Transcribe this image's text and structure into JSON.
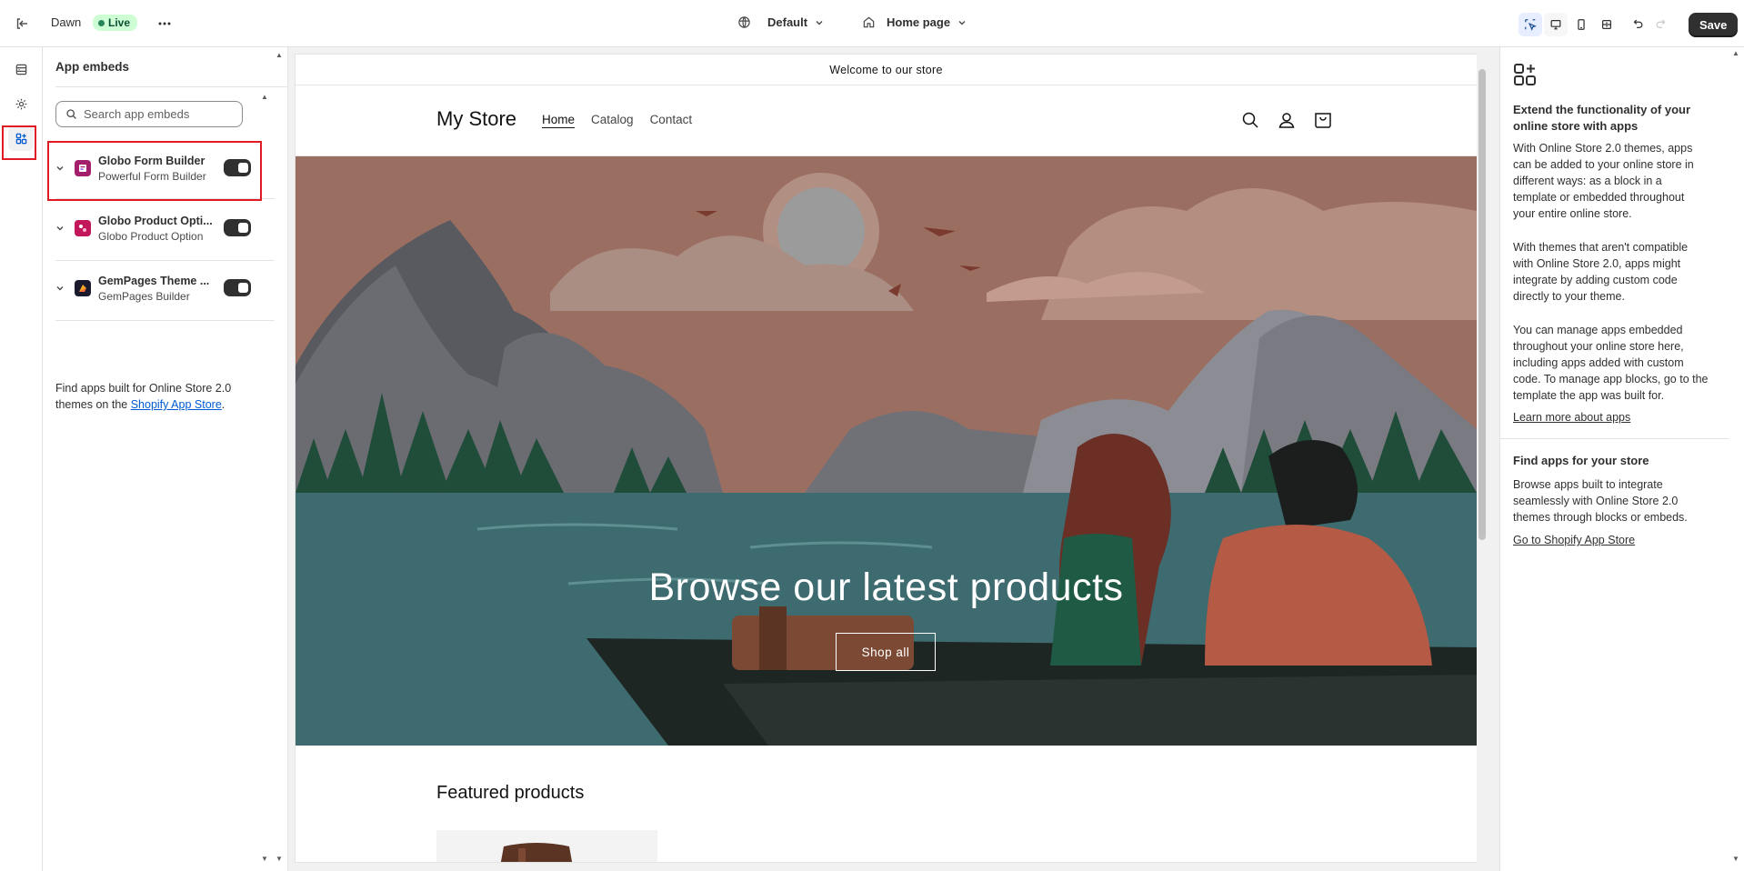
{
  "topbar": {
    "theme_name": "Dawn",
    "live_label": "Live",
    "theme_preset": "Default",
    "page_select": "Home page",
    "save_label": "Save"
  },
  "sidebar": {
    "title": "App embeds",
    "search_placeholder": "Search app embeds",
    "apps": [
      {
        "name": "Globo Form Builder",
        "subtitle": "Powerful Form Builder",
        "enabled": true
      },
      {
        "name": "Globo Product Opti...",
        "subtitle": "Globo Product Option",
        "enabled": true
      },
      {
        "name": "GemPages Theme ...",
        "subtitle": "GemPages Builder",
        "enabled": true
      }
    ],
    "footer_text": "Find apps built for Online Store 2.0 themes on the",
    "footer_link": "Shopify App Store",
    "footer_end": "."
  },
  "preview": {
    "announcement": "Welcome to our store",
    "store_name": "My Store",
    "nav": [
      "Home",
      "Catalog",
      "Contact"
    ],
    "hero_title": "Browse our latest products",
    "hero_button": "Shop all",
    "featured_title": "Featured products"
  },
  "rightpanel": {
    "heading1": "Extend the functionality of your online store with apps",
    "para1": "With Online Store 2.0 themes, apps can be added to your online store in different ways: as a block in a template or embedded throughout your entire online store.",
    "para2": "With themes that aren't compatible with Online Store 2.0, apps might integrate by adding custom code directly to your theme.",
    "para3": "You can manage apps embedded throughout your online store here, including apps added with custom code. To manage app blocks, go to the template the app was built for.",
    "link1": "Learn more about apps",
    "heading2": "Find apps for your store",
    "para4": "Browse apps built to integrate seamlessly with Online Store 2.0 themes through blocks or embeds.",
    "link2": "Go to Shopify App Store"
  },
  "colors": {
    "accent": "#005bd3",
    "highlight": "#e01b24",
    "live_bg": "#cdfed4"
  }
}
